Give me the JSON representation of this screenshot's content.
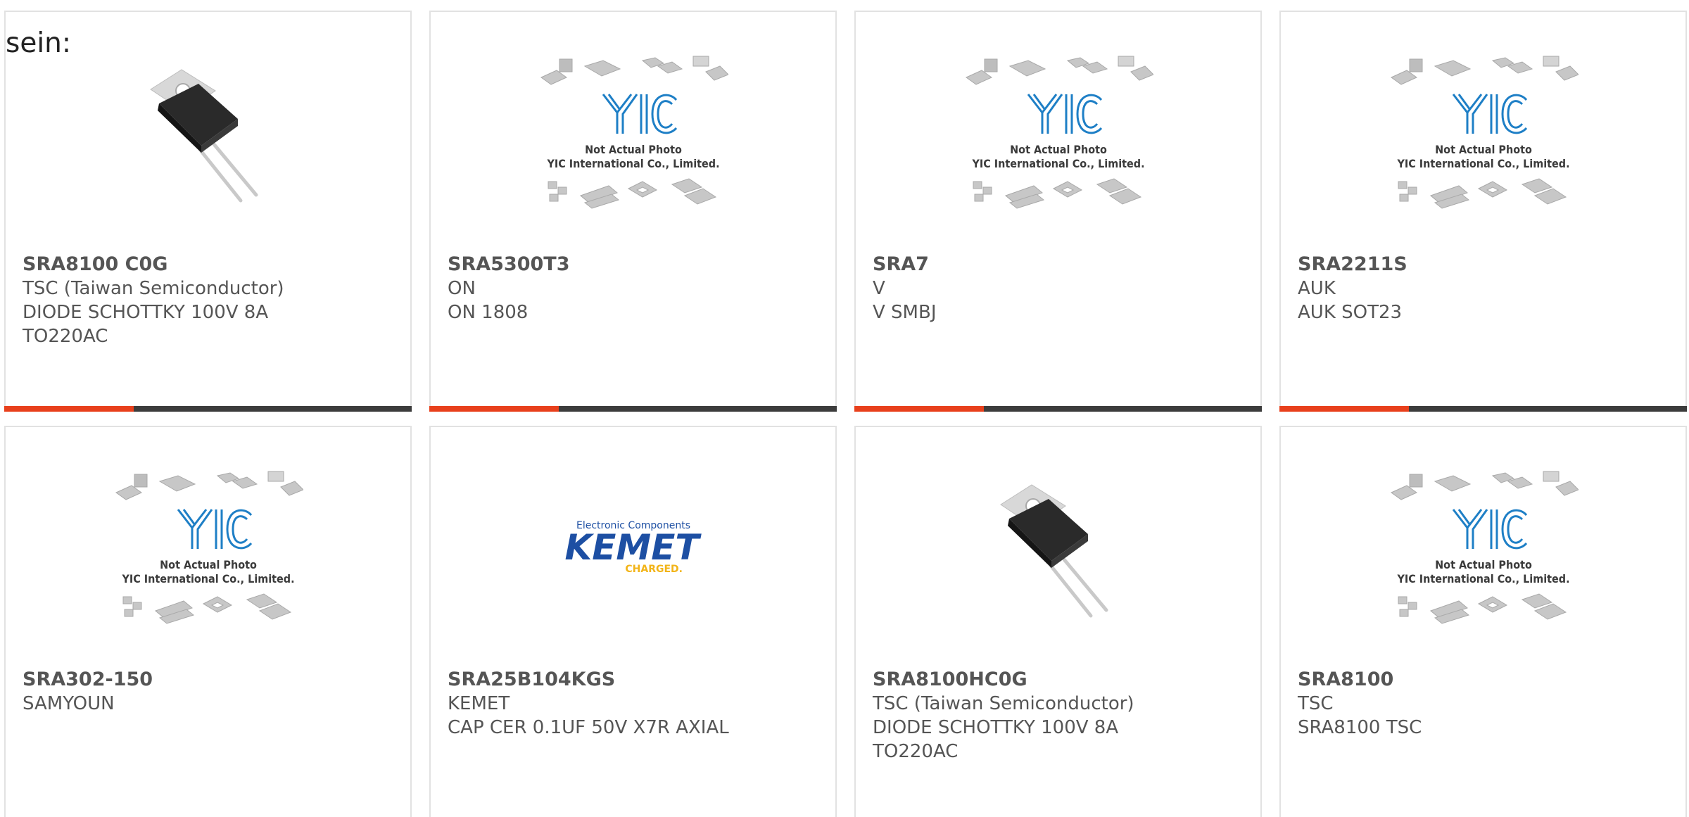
{
  "intro": {
    "text": "sein:"
  },
  "colors": {
    "accent": "#e8401c",
    "bar": "#3c3c3c",
    "yic_blue": "#1e7fc6",
    "kemet_blue": "#1d4fa3",
    "kemet_yellow": "#f2b418"
  },
  "placeholder_image": {
    "line1": "Not Actual Photo",
    "line2": "YIC International Co., Limited."
  },
  "kemet_logo": {
    "tagline": "Electronic Components",
    "name": "KEMET",
    "slogan": "CHARGED."
  },
  "cards": [
    {
      "part": "SRA8100 C0G",
      "manufacturer": "TSC (Taiwan Semiconductor)",
      "description_1": "DIODE SCHOTTKY 100V 8A",
      "description_2": "TO220AC",
      "image": "to220-photo"
    },
    {
      "part": "SRA5300T3",
      "manufacturer": "ON",
      "description_1": "ON 1808",
      "description_2": "",
      "image": "yic-placeholder"
    },
    {
      "part": "SRA7",
      "manufacturer": "V",
      "description_1": "V SMBJ",
      "description_2": "",
      "image": "yic-placeholder"
    },
    {
      "part": "SRA2211S",
      "manufacturer": "AUK",
      "description_1": "AUK SOT23",
      "description_2": "",
      "image": "yic-placeholder"
    },
    {
      "part": "SRA302-150",
      "manufacturer": "SAMYOUN",
      "description_1": "",
      "description_2": "",
      "image": "yic-placeholder"
    },
    {
      "part": "SRA25B104KGS",
      "manufacturer": "KEMET",
      "description_1": "CAP CER 0.1UF 50V X7R AXIAL",
      "description_2": "",
      "image": "kemet-logo"
    },
    {
      "part": "SRA8100HC0G",
      "manufacturer": "TSC (Taiwan Semiconductor)",
      "description_1": "DIODE SCHOTTKY 100V 8A",
      "description_2": "TO220AC",
      "image": "to220-photo"
    },
    {
      "part": "SRA8100",
      "manufacturer": "TSC",
      "description_1": "SRA8100 TSC",
      "description_2": "",
      "image": "yic-placeholder"
    }
  ]
}
